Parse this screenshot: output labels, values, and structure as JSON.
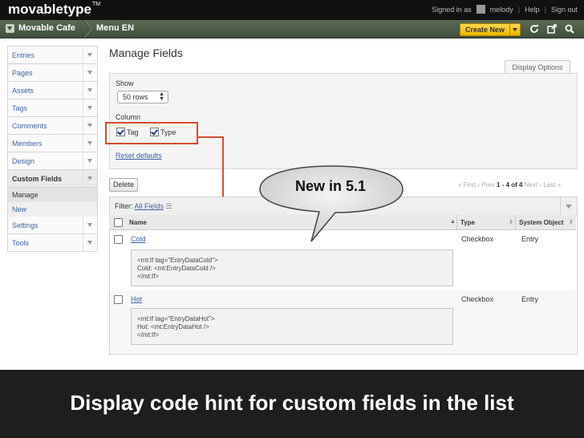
{
  "topbar": {
    "logo": "movabletype",
    "logo_tm": "TM",
    "signed_in_as": "Signed in as",
    "username": "melody",
    "help": "Help",
    "sign_out": "Sign out"
  },
  "nav": {
    "blog_name": "Movable Cafe",
    "menu": "Menu EN",
    "create_new": "Create New"
  },
  "sidebar": {
    "items": [
      {
        "label": "Entries"
      },
      {
        "label": "Pages"
      },
      {
        "label": "Assets"
      },
      {
        "label": "Tags"
      },
      {
        "label": "Comments"
      },
      {
        "label": "Members"
      },
      {
        "label": "Design"
      },
      {
        "label": "Custom Fields"
      }
    ],
    "sub": [
      "Manage",
      "New"
    ],
    "after": [
      {
        "label": "Settings"
      },
      {
        "label": "Tools"
      }
    ]
  },
  "page": {
    "title": "Manage Fields",
    "display_options": "Display Options",
    "show_label": "Show",
    "rows_value": "50 rows",
    "column_label": "Column",
    "col_tag": "Tag",
    "col_type": "Type",
    "reset_defaults": "Reset defaults",
    "delete": "Delete",
    "pager": {
      "first": "« First",
      "prev": "‹ Prev",
      "range": "1 - 4 of 4",
      "next": "Next ›",
      "last": "Last »"
    },
    "filter_prefix": "Filter:",
    "filter_value": "All Fields",
    "headers": {
      "name": "Name",
      "type": "Type",
      "system_object": "System Object"
    },
    "rows": [
      {
        "name": "Cold",
        "type": "Checkbox",
        "system_object": "Entry",
        "code": [
          "<mt:If tag=\"EntryDataCold\">",
          "Cold: <mt:EntryDataCold />",
          "</mt:If>"
        ]
      },
      {
        "name": "Hot",
        "type": "Checkbox",
        "system_object": "Entry",
        "code": [
          "<mt:If tag=\"EntryDataHot\">",
          "Hot: <mt:EntryDataHot />",
          "</mt:If>"
        ]
      }
    ]
  },
  "callout": "New in 5.1",
  "caption": "Display code hint for custom fields in the list",
  "colors": {
    "accent_red": "#d94b2b",
    "nav_green": "#4d5c47",
    "create_yellow": "#f2b400",
    "link_blue": "#3863a8"
  }
}
